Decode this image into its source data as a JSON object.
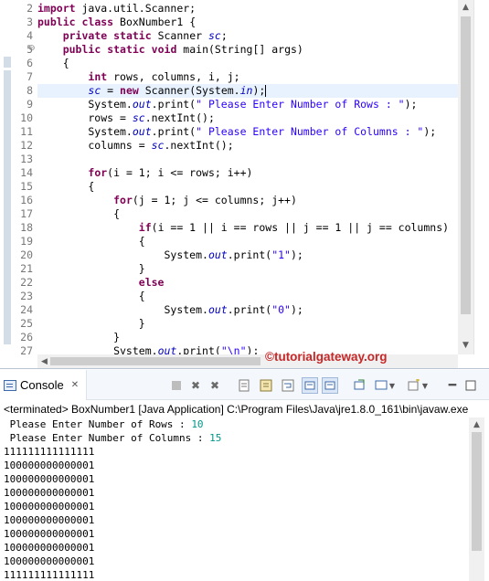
{
  "editor": {
    "line_numbers": [
      "2",
      "3",
      "4",
      "5",
      "6",
      "7",
      "8",
      "9",
      "10",
      "11",
      "12",
      "13",
      "14",
      "15",
      "16",
      "17",
      "18",
      "19",
      "20",
      "21",
      "22",
      "23",
      "24",
      "25",
      "26",
      "27"
    ],
    "fold_marker": "⊖",
    "code_lines": [
      [
        {
          "t": "import",
          "c": "kw"
        },
        {
          "t": " java.util.Scanner;"
        }
      ],
      [
        {
          "t": "public",
          "c": "kw"
        },
        {
          "t": " "
        },
        {
          "t": "class",
          "c": "kw"
        },
        {
          "t": " BoxNumber1 {"
        }
      ],
      [
        {
          "t": "    "
        },
        {
          "t": "private",
          "c": "kw"
        },
        {
          "t": " "
        },
        {
          "t": "static",
          "c": "kw"
        },
        {
          "t": " Scanner "
        },
        {
          "t": "sc",
          "c": "fld"
        },
        {
          "t": ";"
        }
      ],
      [
        {
          "t": "    "
        },
        {
          "t": "public",
          "c": "kw"
        },
        {
          "t": " "
        },
        {
          "t": "static",
          "c": "kw"
        },
        {
          "t": " "
        },
        {
          "t": "void",
          "c": "kw"
        },
        {
          "t": " main(String[] args)"
        }
      ],
      [
        {
          "t": "    {"
        }
      ],
      [
        {
          "t": "        "
        },
        {
          "t": "int",
          "c": "kw"
        },
        {
          "t": " rows, columns, i, j;"
        }
      ],
      [
        {
          "t": "        "
        },
        {
          "t": "sc",
          "c": "fld"
        },
        {
          "t": " = "
        },
        {
          "t": "new",
          "c": "kw"
        },
        {
          "t": " Scanner(System."
        },
        {
          "t": "in",
          "c": "fld"
        },
        {
          "t": ");"
        }
      ],
      [
        {
          "t": "        System."
        },
        {
          "t": "out",
          "c": "fld"
        },
        {
          "t": ".print("
        },
        {
          "t": "\" Please Enter Number of Rows : \"",
          "c": "str"
        },
        {
          "t": ");"
        }
      ],
      [
        {
          "t": "        rows = "
        },
        {
          "t": "sc",
          "c": "fld"
        },
        {
          "t": ".nextInt();"
        }
      ],
      [
        {
          "t": "        System."
        },
        {
          "t": "out",
          "c": "fld"
        },
        {
          "t": ".print("
        },
        {
          "t": "\" Please Enter Number of Columns : \"",
          "c": "str"
        },
        {
          "t": ");"
        }
      ],
      [
        {
          "t": "        columns = "
        },
        {
          "t": "sc",
          "c": "fld"
        },
        {
          "t": ".nextInt();"
        }
      ],
      [
        {
          "t": ""
        }
      ],
      [
        {
          "t": "        "
        },
        {
          "t": "for",
          "c": "kw"
        },
        {
          "t": "(i = 1; i <= rows; i++)"
        }
      ],
      [
        {
          "t": "        {"
        }
      ],
      [
        {
          "t": "            "
        },
        {
          "t": "for",
          "c": "kw"
        },
        {
          "t": "(j = 1; j <= columns; j++)"
        }
      ],
      [
        {
          "t": "            {"
        }
      ],
      [
        {
          "t": "                "
        },
        {
          "t": "if",
          "c": "kw"
        },
        {
          "t": "(i == 1 || i == rows || j == 1 || j == columns)"
        }
      ],
      [
        {
          "t": "                {"
        }
      ],
      [
        {
          "t": "                    System."
        },
        {
          "t": "out",
          "c": "fld"
        },
        {
          "t": ".print("
        },
        {
          "t": "\"1\"",
          "c": "str"
        },
        {
          "t": ");"
        }
      ],
      [
        {
          "t": "                }"
        }
      ],
      [
        {
          "t": "                "
        },
        {
          "t": "else",
          "c": "kw"
        }
      ],
      [
        {
          "t": "                {"
        }
      ],
      [
        {
          "t": "                    System."
        },
        {
          "t": "out",
          "c": "fld"
        },
        {
          "t": ".print("
        },
        {
          "t": "\"0\"",
          "c": "str"
        },
        {
          "t": ");"
        }
      ],
      [
        {
          "t": "                }"
        }
      ],
      [
        {
          "t": "            }"
        }
      ],
      [
        {
          "t": "            System."
        },
        {
          "t": "out",
          "c": "fld"
        },
        {
          "t": ".print("
        },
        {
          "t": "\"\\n\"",
          "c": "str"
        },
        {
          "t": ");"
        }
      ]
    ],
    "watermark": "©tutorialgateway.org"
  },
  "console": {
    "tab_label": "Console",
    "tab_icon": "console-icon",
    "close_icon": "close-icon",
    "toolbar_icons": [
      "terminate-icon",
      "remove-launch-icon",
      "remove-all-terminated-icon",
      "clear-console-icon",
      "scroll-lock-icon",
      "word-wrap-icon",
      "pin-console-icon",
      "display-selected-console-icon",
      "open-console-icon",
      "view-menu-icon",
      "minimize-icon",
      "maximize-icon"
    ],
    "status": "<terminated> BoxNumber1 [Java Application] C:\\Program Files\\Java\\jre1.8.0_161\\bin\\javaw.exe",
    "prompt_rows": " Please Enter Number of Rows : ",
    "rows_value": "10",
    "prompt_columns": " Please Enter Number of Columns : ",
    "columns_value": "15",
    "output_lines": [
      "111111111111111",
      "100000000000001",
      "100000000000001",
      "100000000000001",
      "100000000000001",
      "100000000000001",
      "100000000000001",
      "100000000000001",
      "100000000000001",
      "111111111111111"
    ]
  },
  "colors": {
    "keyword": "#7f0055",
    "string": "#2a00ff",
    "field": "#0000c0",
    "console_input": "#009688",
    "watermark": "#c62828"
  }
}
